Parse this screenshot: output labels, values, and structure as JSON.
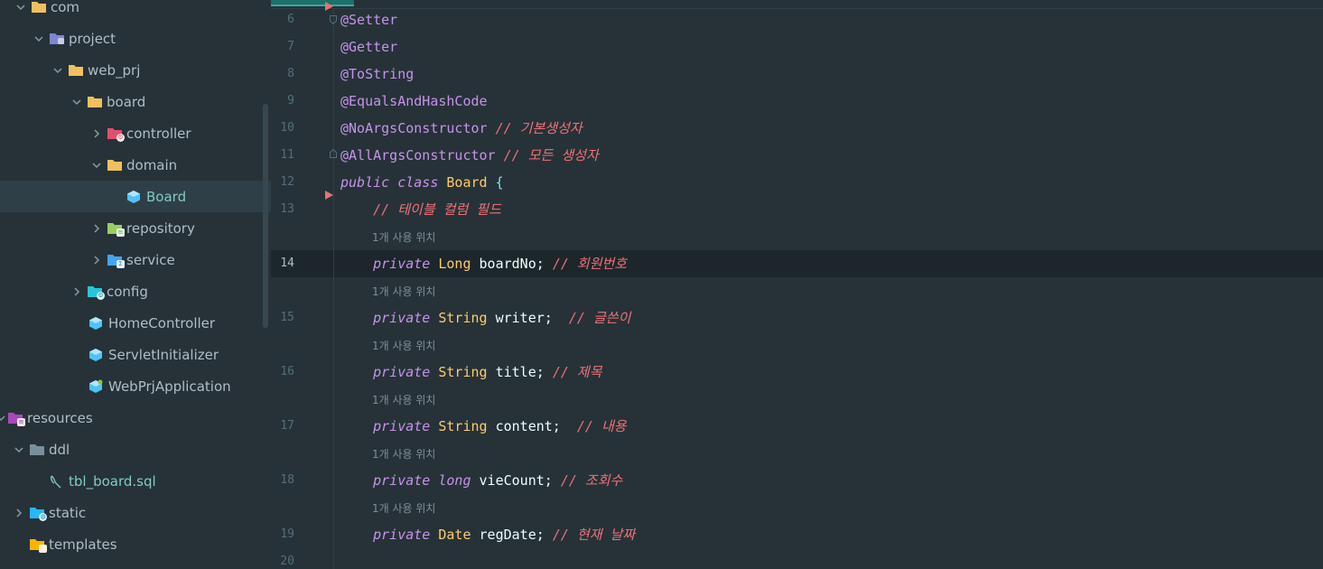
{
  "project_tree": {
    "items": [
      {
        "label": "com",
        "icon": "folder-icon"
      },
      {
        "label": "project",
        "icon": "package-folder-icon"
      },
      {
        "label": "web_prj",
        "icon": "folder-icon"
      },
      {
        "label": "board",
        "icon": "folder-icon"
      },
      {
        "label": "controller",
        "icon": "controller-folder-icon"
      },
      {
        "label": "domain",
        "icon": "folder-icon"
      },
      {
        "label": "Board",
        "icon": "class-icon"
      },
      {
        "label": "repository",
        "icon": "repository-folder-icon"
      },
      {
        "label": "service",
        "icon": "service-folder-icon"
      },
      {
        "label": "config",
        "icon": "config-folder-icon"
      },
      {
        "label": "HomeController",
        "icon": "class-icon"
      },
      {
        "label": "ServletInitializer",
        "icon": "class-icon"
      },
      {
        "label": "WebPrjApplication",
        "icon": "spring-class-icon"
      },
      {
        "label": "resources",
        "icon": "resources-folder-icon"
      },
      {
        "label": "ddl",
        "icon": "folder-icon"
      },
      {
        "label": "tbl_board.sql",
        "icon": "sql-file-icon"
      },
      {
        "label": "static",
        "icon": "static-folder-icon"
      },
      {
        "label": "templates",
        "icon": "templates-folder-icon"
      }
    ]
  },
  "editor": {
    "usage_hint": "1개 사용 위치",
    "line_numbers": [
      "6",
      "7",
      "8",
      "9",
      "10",
      "11",
      "12",
      "13",
      "14",
      "15",
      "16",
      "17",
      "18",
      "19",
      "20"
    ],
    "code": {
      "l6": "@Setter",
      "l7": "@Getter",
      "l8": "@ToString",
      "l9": "@EqualsAndHashCode",
      "l10_ann": "@NoArgsConstructor",
      "l10_cmt": "// 기본생성자",
      "l11_ann": "@AllArgsConstructor",
      "l11_cmt": "// 모든 생성자",
      "l12_kw": "public class",
      "l12_name": "Board",
      "l12_brace": "{",
      "l13_cmt": "// 테이블 컬럼 필드",
      "private_kw": "private",
      "l14_type": "Long",
      "l14_name": "boardNo;",
      "l14_cmt": "// 회원번호",
      "l15_type": "String",
      "l15_name": "writer;",
      "l15_cmt": "// 글쓴이",
      "l16_type": "String",
      "l16_name": "title;",
      "l16_cmt": "// 제목",
      "l17_type": "String",
      "l17_name": "content;",
      "l17_cmt": "// 내용",
      "l18_type": "long",
      "l18_name": "vieCount;",
      "l18_cmt": "// 조회수",
      "l19_type": "Date",
      "l19_name": "regDate;",
      "l19_cmt": "// 현재 날짜"
    }
  },
  "colors": {
    "background": "#263238",
    "annotation": "#c792ea",
    "keyword": "#c792ea",
    "type": "#ffcb6b",
    "comment": "#f07178",
    "identifier": "#eeffff",
    "selection_text": "#80cbc4"
  }
}
